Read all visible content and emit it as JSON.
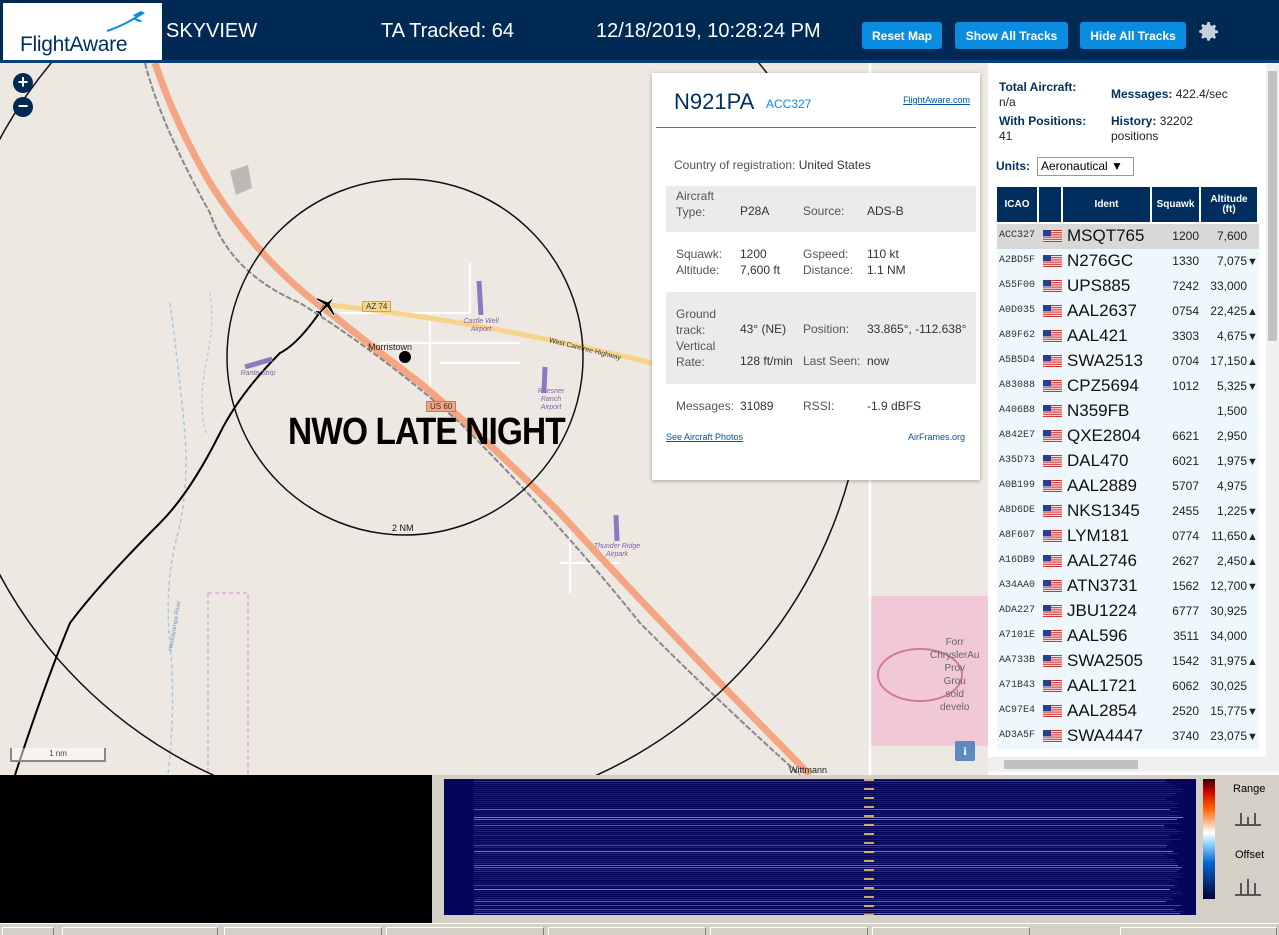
{
  "header": {
    "logo_text": "FlightAware",
    "app_title": "SKYVIEW",
    "ta_tracked": "TA Tracked: 64",
    "datetime": "12/18/2019, 10:28:24 PM",
    "buttons": {
      "reset_map": "Reset Map",
      "show_all_tracks": "Show All Tracks",
      "hide_all_tracks": "Hide All Tracks"
    },
    "settings_icon": "gear-icon"
  },
  "map": {
    "zoom_in": "+",
    "zoom_out": "−",
    "watermark": "NWO LATE NIGHT",
    "range_ring_label": "2 NM",
    "scale_bar": "1 nm",
    "info_button": "i",
    "places": {
      "morristown": "Morristown",
      "wittmann": "Wittmann",
      "az74": "AZ 74",
      "us60": "US 60",
      "west_carefree": "West Carefree Highway",
      "ranta_strip": "Ranta Strip",
      "castle_well": "Castle Well Airport",
      "roesner": "Roesner Ranch Airport",
      "thunder_ridge": "Thunder Ridge Airpark",
      "chrysler_1": "Forr",
      "chrysler_2": "ChryslerAu",
      "chrysler_3": "Prov",
      "chrysler_4": "Grou",
      "chrysler_5": "sold",
      "chrysler_6": "develo",
      "hassayampa": "Hassayampa River"
    }
  },
  "popup": {
    "registration": "N921PA",
    "icao": "ACC327",
    "fa_link": "FlightAware.com",
    "country_label": "Country of registration:",
    "country_value": "United States",
    "aircraft_type_label": "Aircraft Type:",
    "aircraft_type_label_1": "Aircraft",
    "aircraft_type_label_2": "Type:",
    "aircraft_type_value": "P28A",
    "source_label": "Source:",
    "source_value": "ADS-B",
    "squawk_label": "Squawk:",
    "squawk_value": "1200",
    "gspeed_label": "Gspeed:",
    "gspeed_value": "110 kt",
    "altitude_label": "Altitude:",
    "altitude_value": "7,600 ft",
    "distance_label": "Distance:",
    "distance_value": "1.1 NM",
    "ground_track_label_1": "Ground",
    "ground_track_label_2": "track:",
    "ground_track_value": "43° (NE)",
    "position_label": "Position:",
    "position_value": "33.865°, -112.638°",
    "vertical_rate_label_1": "Vertical",
    "vertical_rate_label_2": "Rate:",
    "vertical_rate_value": "128 ft/min",
    "last_seen_label": "Last Seen:",
    "last_seen_value": "now",
    "messages_label": "Messages:",
    "messages_value": "31089",
    "rssi_label": "RSSI:",
    "rssi_value": "-1.9 dBFS",
    "photos_link": "See Aircraft Photos",
    "airframes_link": "AirFrames.org"
  },
  "panel": {
    "total_aircraft_label": "Total Aircraft:",
    "total_aircraft_value": "n/a",
    "messages_label": "Messages:",
    "messages_value": "422.4/sec",
    "with_positions_label": "With Positions:",
    "with_positions_value": "41",
    "history_label": "History:",
    "history_value": "32202",
    "history_unit": "positions",
    "units_label": "Units:",
    "units_value": "Aeronautical ▼",
    "columns": {
      "icao": "ICAO",
      "ident": "Ident",
      "squawk": "Squawk",
      "altitude": "Altitude (ft)"
    },
    "rows": [
      {
        "icao": "ACC327",
        "ident": "MSQT765",
        "squawk": "1200",
        "altitude": "7,600",
        "trend": "",
        "selected": true
      },
      {
        "icao": "A2BD5F",
        "ident": "N276GC",
        "squawk": "1330",
        "altitude": "7,075",
        "trend": "▼",
        "selected": false
      },
      {
        "icao": "A55F00",
        "ident": "UPS885",
        "squawk": "7242",
        "altitude": "33,000",
        "trend": "",
        "selected": false
      },
      {
        "icao": "A0D035",
        "ident": "AAL2637",
        "squawk": "0754",
        "altitude": "22,425",
        "trend": "▲",
        "selected": false
      },
      {
        "icao": "A89F62",
        "ident": "AAL421",
        "squawk": "3303",
        "altitude": "4,675",
        "trend": "▼",
        "selected": false
      },
      {
        "icao": "A5B5D4",
        "ident": "SWA2513",
        "squawk": "0704",
        "altitude": "17,150",
        "trend": "▲",
        "selected": false
      },
      {
        "icao": "A83088",
        "ident": "CPZ5694",
        "squawk": "1012",
        "altitude": "5,325",
        "trend": "▼",
        "selected": false
      },
      {
        "icao": "A406B8",
        "ident": "N359FB",
        "squawk": "",
        "altitude": "1,500",
        "trend": "",
        "selected": false
      },
      {
        "icao": "A842E7",
        "ident": "QXE2804",
        "squawk": "6621",
        "altitude": "2,950",
        "trend": "",
        "selected": false
      },
      {
        "icao": "A35D73",
        "ident": "DAL470",
        "squawk": "6021",
        "altitude": "1,975",
        "trend": "▼",
        "selected": false
      },
      {
        "icao": "A0B199",
        "ident": "AAL2889",
        "squawk": "5707",
        "altitude": "4,975",
        "trend": "",
        "selected": false
      },
      {
        "icao": "A8D6DE",
        "ident": "NKS1345",
        "squawk": "2455",
        "altitude": "1,225",
        "trend": "▼",
        "selected": false
      },
      {
        "icao": "A8F607",
        "ident": "LYM181",
        "squawk": "0774",
        "altitude": "11,650",
        "trend": "▲",
        "selected": false
      },
      {
        "icao": "A16DB9",
        "ident": "AAL2746",
        "squawk": "2627",
        "altitude": "2,450",
        "trend": "▲",
        "selected": false
      },
      {
        "icao": "A34AA0",
        "ident": "ATN3731",
        "squawk": "1562",
        "altitude": "12,700",
        "trend": "▼",
        "selected": false
      },
      {
        "icao": "ADA227",
        "ident": "JBU1224",
        "squawk": "6777",
        "altitude": "30,925",
        "trend": "",
        "selected": false
      },
      {
        "icao": "A7101E",
        "ident": "AAL596",
        "squawk": "3511",
        "altitude": "34,000",
        "trend": "",
        "selected": false
      },
      {
        "icao": "AA733B",
        "ident": "SWA2505",
        "squawk": "1542",
        "altitude": "31,975",
        "trend": "▲",
        "selected": false
      },
      {
        "icao": "A71B43",
        "ident": "AAL1721",
        "squawk": "6062",
        "altitude": "30,025",
        "trend": "",
        "selected": false
      },
      {
        "icao": "AC97E4",
        "ident": "AAL2854",
        "squawk": "2520",
        "altitude": "15,775",
        "trend": "▼",
        "selected": false
      },
      {
        "icao": "AD3A5F",
        "ident": "SWA4447",
        "squawk": "3740",
        "altitude": "23,075",
        "trend": "▼",
        "selected": false
      }
    ]
  },
  "spectrum": {
    "range_label": "Range",
    "offset_label": "Offset"
  },
  "colors": {
    "header_bg": "#002a54",
    "button_blue": "#0a8ce0",
    "road": "#f4a582",
    "map_bg": "#ede9e2",
    "table_head": "#002f5f"
  }
}
